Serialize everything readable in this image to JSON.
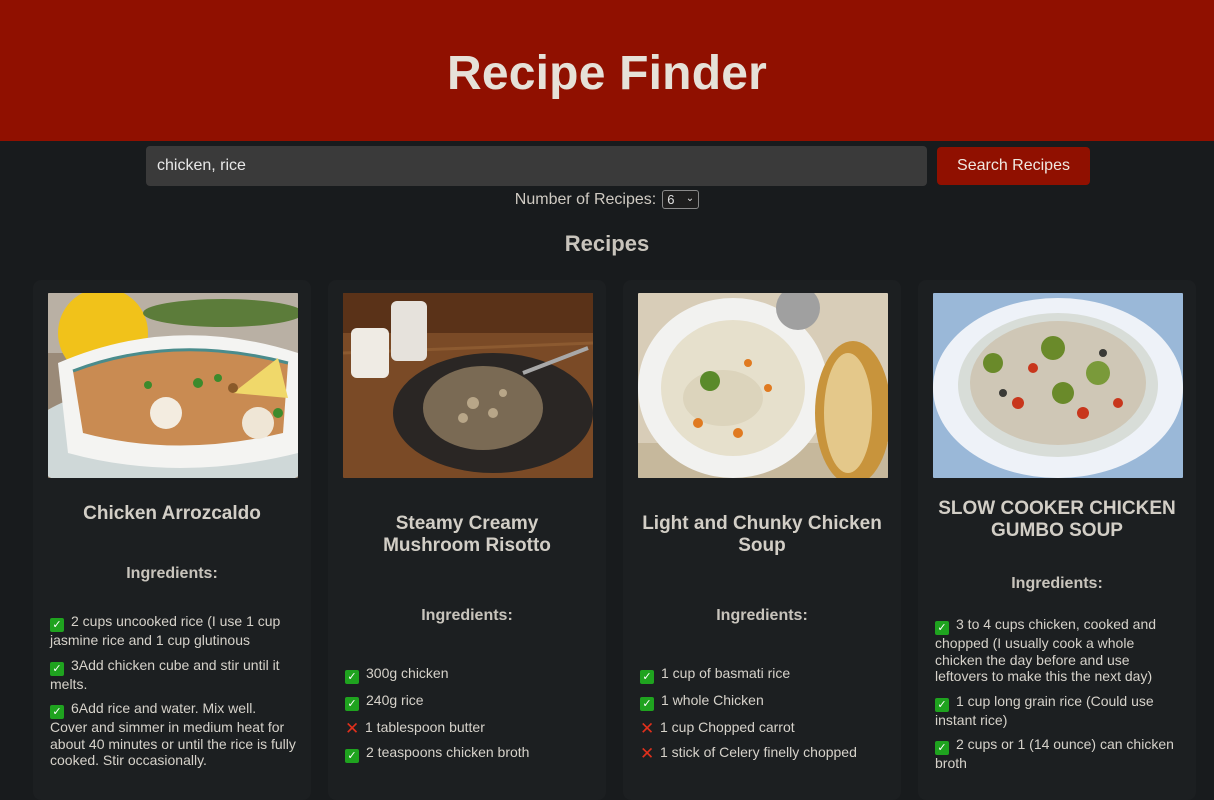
{
  "header": {
    "title": "Recipe Finder"
  },
  "search": {
    "value": "chicken, rice",
    "button_label": "Search Recipes"
  },
  "count": {
    "label": "Number of Recipes:",
    "value": "6"
  },
  "section_title": "Recipes",
  "ingredients_label": "Ingredients:",
  "recipes": [
    {
      "title": "Chicken Arrozcaldo",
      "ingredients": [
        {
          "text": "2 cups uncooked rice (I use 1 cup jasmine rice and 1 cup glutinous",
          "have": true
        },
        {
          "text": "3Add chicken cube and stir until it melts.",
          "have": true
        },
        {
          "text": "6Add rice and water. Mix well. Cover and simmer in medium heat for about 40 minutes or until the rice is fully cooked. Stir occasionally.",
          "have": true
        }
      ]
    },
    {
      "title": "Steamy Creamy Mushroom Risotto",
      "ingredients": [
        {
          "text": "300g chicken",
          "have": true
        },
        {
          "text": "240g rice",
          "have": true
        },
        {
          "text": "1 tablespoon butter",
          "have": false
        },
        {
          "text": "2 teaspoons chicken broth",
          "have": true
        }
      ]
    },
    {
      "title": "Light and Chunky Chicken Soup",
      "ingredients": [
        {
          "text": "1 cup of basmati rice",
          "have": true
        },
        {
          "text": "1 whole Chicken",
          "have": true
        },
        {
          "text": "1 cup Chopped carrot",
          "have": false
        },
        {
          "text": "1 stick of Celery finelly chopped",
          "have": false
        }
      ]
    },
    {
      "title": "SLOW COOKER CHICKEN GUMBO SOUP",
      "ingredients": [
        {
          "text": "3 to 4 cups chicken, cooked and chopped (I usually cook a whole chicken the day before and use leftovers to make this the next day)",
          "have": true
        },
        {
          "text": "1 cup long grain rice (Could use instant rice)",
          "have": true
        },
        {
          "text": "2 cups or 1 (14 ounce) can chicken broth",
          "have": true
        }
      ]
    }
  ]
}
